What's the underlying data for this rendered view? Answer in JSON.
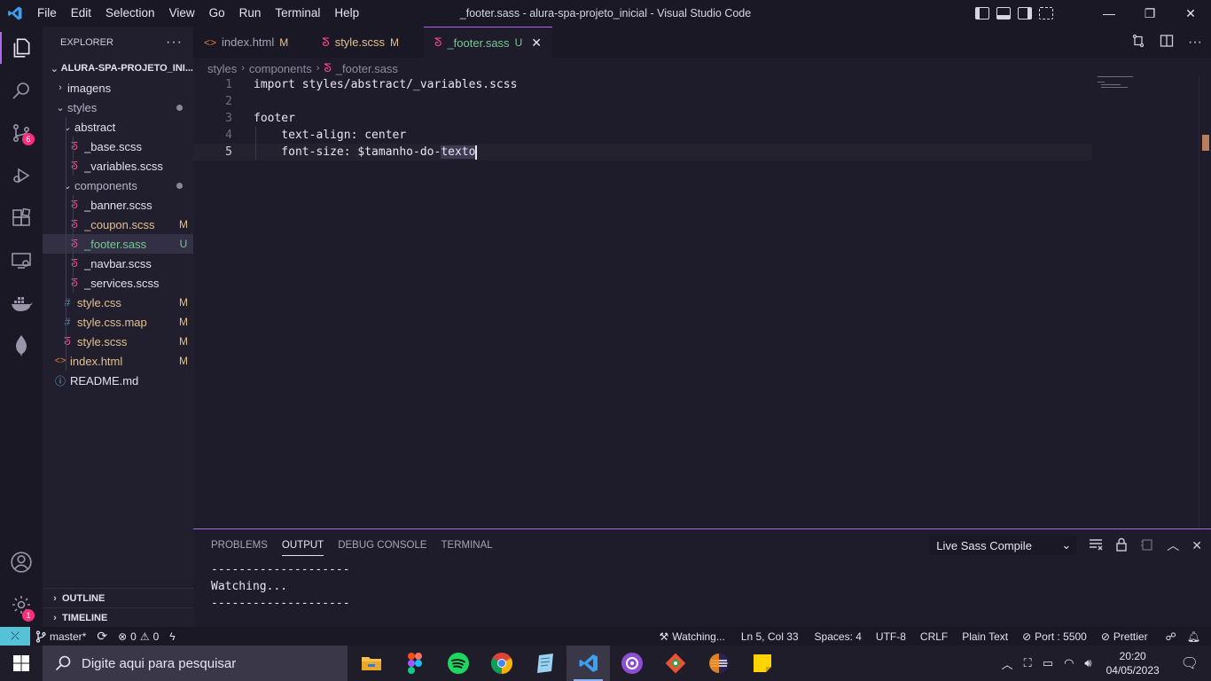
{
  "window": {
    "title": "_footer.sass - alura-spa-projeto_inicial - Visual Studio Code",
    "menu": [
      "File",
      "Edit",
      "Selection",
      "View",
      "Go",
      "Run",
      "Terminal",
      "Help"
    ],
    "controls": {
      "minimize": "—",
      "restore": "❐",
      "close": "✕"
    }
  },
  "activity_bar": {
    "items": [
      {
        "name": "explorer-icon"
      },
      {
        "name": "search-icon"
      },
      {
        "name": "source-control-icon",
        "badge": "6"
      },
      {
        "name": "run-debug-icon"
      },
      {
        "name": "extensions-icon"
      },
      {
        "name": "remote-explorer-icon"
      },
      {
        "name": "docker-icon"
      },
      {
        "name": "mongodb-icon"
      }
    ],
    "bottom": [
      {
        "name": "accounts-icon"
      },
      {
        "name": "manage-gear-icon",
        "badge": "1"
      }
    ]
  },
  "sidebar": {
    "title": "EXPLORER",
    "root": "ALURA-SPA-PROJETO_INI...",
    "tree": [
      {
        "label": "imagens",
        "type": "folder",
        "collapsed": true,
        "status": ""
      },
      {
        "label": "styles",
        "type": "folder",
        "status": "dot"
      },
      {
        "label": "abstract",
        "type": "folder",
        "status": ""
      },
      {
        "label": "_base.scss",
        "type": "sass",
        "status": ""
      },
      {
        "label": "_variables.scss",
        "type": "sass",
        "status": ""
      },
      {
        "label": "components",
        "type": "folder",
        "status": "dot"
      },
      {
        "label": "_banner.scss",
        "type": "sass",
        "status": ""
      },
      {
        "label": "_coupon.scss",
        "type": "sass",
        "status": "M"
      },
      {
        "label": "_footer.sass",
        "type": "sass",
        "status": "U"
      },
      {
        "label": "_navbar.scss",
        "type": "sass",
        "status": ""
      },
      {
        "label": "_services.scss",
        "type": "sass",
        "status": ""
      },
      {
        "label": "style.css",
        "type": "css",
        "status": "M"
      },
      {
        "label": "style.css.map",
        "type": "css",
        "status": "M"
      },
      {
        "label": "style.scss",
        "type": "sass",
        "status": "M"
      },
      {
        "label": "index.html",
        "type": "html",
        "status": "M"
      },
      {
        "label": "README.md",
        "type": "info",
        "status": ""
      }
    ],
    "outline": "OUTLINE",
    "timeline": "TIMELINE"
  },
  "tabs": [
    {
      "label": "index.html",
      "status": "M"
    },
    {
      "label": "style.scss",
      "status": "M"
    },
    {
      "label": "_footer.sass",
      "status": "U",
      "close": "✕"
    }
  ],
  "breadcrumb": [
    "styles",
    "components",
    "_footer.sass"
  ],
  "editor": {
    "lines": [
      {
        "n": "1",
        "text": "import styles/abstract/_variables.scss"
      },
      {
        "n": "2",
        "text": ""
      },
      {
        "n": "3",
        "text": "footer"
      },
      {
        "n": "4",
        "text": "    text-align: center"
      },
      {
        "n": "5",
        "text_before": "    font-size: $tamanho-do-",
        "text_sel": "texto"
      }
    ]
  },
  "panel": {
    "tabs": [
      "PROBLEMS",
      "OUTPUT",
      "DEBUG CONSOLE",
      "TERMINAL"
    ],
    "active_tab": "OUTPUT",
    "channel": "Live Sass Compile",
    "output": "--------------------\nWatching...\n--------------------"
  },
  "statusbar": {
    "branch": "master*",
    "errors": "0",
    "warnings": "0",
    "watching": "Watching...",
    "position": "Ln 5, Col 33",
    "spaces": "Spaces: 4",
    "encoding": "UTF-8",
    "eol": "CRLF",
    "language": "Plain Text",
    "port": "Port : 5500",
    "prettier": "Prettier"
  },
  "taskbar": {
    "search_placeholder": "Digite aqui para pesquisar",
    "apps": [
      "file-explorer-icon",
      "figma-icon",
      "spotify-icon",
      "chrome-icon",
      "notepad-icon",
      "vscode-icon",
      "github-desktop-icon",
      "git-icon",
      "eclipse-icon",
      "sticky-notes-icon"
    ],
    "time": "20:20",
    "date": "04/05/2023"
  },
  "colors": {
    "accent": "#b066e8",
    "sass": "#ff4d8d",
    "untracked": "#73c991",
    "modified": "#e2c08d",
    "html": "#e37933",
    "css": "#519aba"
  }
}
